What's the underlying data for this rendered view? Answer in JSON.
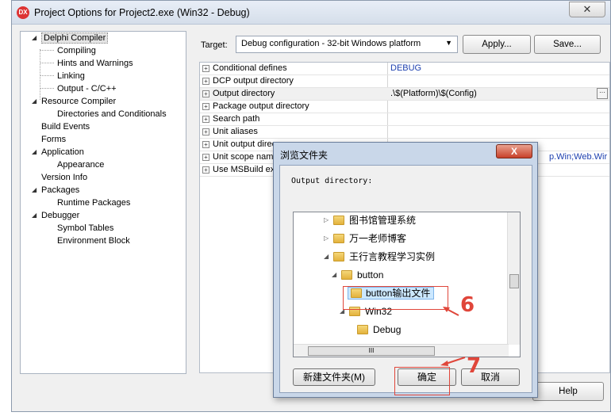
{
  "window": {
    "title": "Project Options for Project2.exe  (Win32 - Debug)",
    "icon": "DX",
    "close": "✕"
  },
  "tree": {
    "items": [
      {
        "label": "Delphi Compiler"
      },
      {
        "label": "Compiling"
      },
      {
        "label": "Hints and Warnings"
      },
      {
        "label": "Linking"
      },
      {
        "label": "Output - C/C++"
      },
      {
        "label": "Resource Compiler"
      },
      {
        "label": "Directories and Conditionals"
      },
      {
        "label": "Build Events"
      },
      {
        "label": "Forms"
      },
      {
        "label": "Application"
      },
      {
        "label": "Appearance"
      },
      {
        "label": "Version Info"
      },
      {
        "label": "Packages"
      },
      {
        "label": "Runtime Packages"
      },
      {
        "label": "Debugger"
      },
      {
        "label": "Symbol Tables"
      },
      {
        "label": "Environment Block"
      }
    ]
  },
  "target": {
    "label": "Target:",
    "value": "Debug configuration - 32-bit Windows platform",
    "apply": "Apply...",
    "save": "Save..."
  },
  "grid": {
    "rows": [
      {
        "name": "Conditional defines",
        "value": "DEBUG"
      },
      {
        "name": "DCP output directory",
        "value": ""
      },
      {
        "name": "Output directory",
        "value": ".\\$(Platform)\\$(Config)"
      },
      {
        "name": "Package output directory",
        "value": ""
      },
      {
        "name": "Search path",
        "value": ""
      },
      {
        "name": "Unit aliases",
        "value": ""
      },
      {
        "name": "Unit output direc",
        "value": ""
      },
      {
        "name": "Unit scope name",
        "value": "p.Win;Web.Wir"
      },
      {
        "name": "Use MSBuild exte",
        "value": ""
      }
    ],
    "ellipsis": "···"
  },
  "help_button": "Help",
  "dialog": {
    "title": "浏览文件夹",
    "close": "X",
    "label": "Output directory:",
    "folders": [
      {
        "label": "图书馆管理系统"
      },
      {
        "label": "万一老师博客"
      },
      {
        "label": "王行言教程学习实例"
      },
      {
        "label": "button"
      },
      {
        "label": "button输出文件"
      },
      {
        "label": "Win32"
      },
      {
        "label": "Debug"
      }
    ],
    "hscroll_grip": "III",
    "new_folder": "新建文件夹(M)",
    "ok": "确定",
    "cancel": "取消"
  },
  "annotations": {
    "step6": "6",
    "step7": "7",
    "color": "#e0463a"
  }
}
